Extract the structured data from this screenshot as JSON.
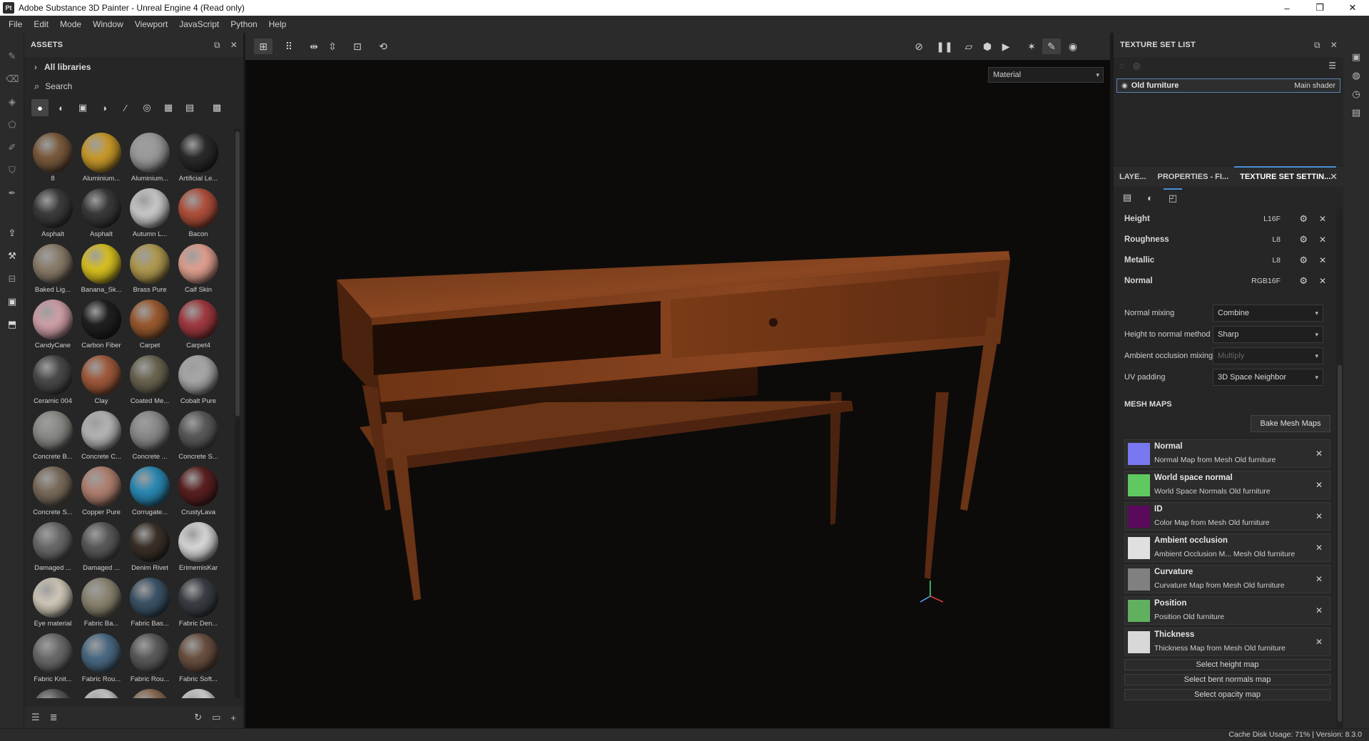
{
  "window": {
    "title": "Adobe Substance 3D Painter - Unreal Engine 4 (Read only)",
    "app_icon": "Pt",
    "controls": [
      "–",
      "❐",
      "✕"
    ]
  },
  "menu": [
    "File",
    "Edit",
    "Mode",
    "Window",
    "Viewport",
    "JavaScript",
    "Python",
    "Help"
  ],
  "assets_panel": {
    "title": "ASSETS",
    "library": "All libraries",
    "search_placeholder": "Search",
    "items": [
      {
        "label": "8",
        "color": "#7a5a3c"
      },
      {
        "label": "Aluminium...",
        "color": "#c99a2a"
      },
      {
        "label": "Aluminium...",
        "color": "#9a9a9a"
      },
      {
        "label": "Artificial Le...",
        "color": "#2a2a2a"
      },
      {
        "label": "Asphalt",
        "color": "#3c3c3c"
      },
      {
        "label": "Asphalt",
        "color": "#3a3a3a"
      },
      {
        "label": "Autumn L...",
        "color": "#c9c9c9"
      },
      {
        "label": "Bacon",
        "color": "#b0503c"
      },
      {
        "label": "Baked Lig...",
        "color": "#8a7c6a"
      },
      {
        "label": "Banana_Sk...",
        "color": "#d8c020"
      },
      {
        "label": "Brass Pure",
        "color": "#b09a50"
      },
      {
        "label": "Calf Skin",
        "color": "#e0a090"
      },
      {
        "label": "CandyCane",
        "color": "#d0a0a8"
      },
      {
        "label": "Carbon Fiber",
        "color": "#202020"
      },
      {
        "label": "Carpet",
        "color": "#9a5a30"
      },
      {
        "label": "Carpet4",
        "color": "#a03a40"
      },
      {
        "label": "Ceramic 004",
        "color": "#4a4a4a"
      },
      {
        "label": "Clay",
        "color": "#a05a3c"
      },
      {
        "label": "Coated Me...",
        "color": "#6a6450"
      },
      {
        "label": "Cobalt Pure",
        "color": "#a8a8a8"
      },
      {
        "label": "Concrete B...",
        "color": "#8a8a86"
      },
      {
        "label": "Concrete C...",
        "color": "#b4b4b4"
      },
      {
        "label": "Concrete ...",
        "color": "#8a8a8a"
      },
      {
        "label": "Concrete S...",
        "color": "#5a5a5a"
      },
      {
        "label": "Concrete S...",
        "color": "#7a6c5c"
      },
      {
        "label": "Copper Pure",
        "color": "#b08070"
      },
      {
        "label": "Corrugate...",
        "color": "#2a8ab4"
      },
      {
        "label": "CrustyLava",
        "color": "#5a2020"
      },
      {
        "label": "Damaged ...",
        "color": "#6a6a6a"
      },
      {
        "label": "Damaged ...",
        "color": "#5a5a5a"
      },
      {
        "label": "Denim Rivet",
        "color": "#3a3028"
      },
      {
        "label": "ErimemisKar",
        "color": "#d8d8d8"
      },
      {
        "label": "Eye material",
        "color": "#d0c8b8"
      },
      {
        "label": "Fabric Ba...",
        "color": "#8a8470"
      },
      {
        "label": "Fabric Bas...",
        "color": "#3c5468"
      },
      {
        "label": "Fabric Den...",
        "color": "#3a3e44"
      },
      {
        "label": "Fabric Knit...",
        "color": "#6a6a6a"
      },
      {
        "label": "Fabric Rou...",
        "color": "#4a6a84"
      },
      {
        "label": "Fabric Rou...",
        "color": "#5a5a5a"
      },
      {
        "label": "Fabric Soft...",
        "color": "#6a5040"
      },
      {
        "label": "",
        "color": "#5a5a5a"
      },
      {
        "label": "",
        "color": "#c8c8c8"
      },
      {
        "label": "",
        "color": "#8a6a50"
      },
      {
        "label": "",
        "color": "#d0d0d0"
      }
    ]
  },
  "viewport": {
    "mode_dropdown": "Material"
  },
  "texture_set_list": {
    "title": "TEXTURE SET LIST",
    "item_name": "Old furniture",
    "item_shader": "Main shader"
  },
  "tabs": {
    "layers": "LAYE...",
    "properties": "PROPERTIES - FI...",
    "tss": "TEXTURE SET SETTIN..."
  },
  "channels": [
    {
      "name": "Height",
      "format": "L16F"
    },
    {
      "name": "Roughness",
      "format": "L8"
    },
    {
      "name": "Metallic",
      "format": "L8"
    },
    {
      "name": "Normal",
      "format": "RGB16F"
    }
  ],
  "settings": [
    {
      "label": "Normal mixing",
      "value": "Combine",
      "disabled": false
    },
    {
      "label": "Height to normal method",
      "value": "Sharp",
      "disabled": false
    },
    {
      "label": "Ambient occlusion mixing",
      "value": "Multiply",
      "disabled": true
    },
    {
      "label": "UV padding",
      "value": "3D Space Neighbor",
      "disabled": false
    }
  ],
  "mesh_maps": {
    "title": "MESH MAPS",
    "bake_button": "Bake Mesh Maps",
    "items": [
      {
        "name": "Normal",
        "desc": "Normal Map from Mesh Old furniture",
        "thumb": "#7878f0"
      },
      {
        "name": "World space normal",
        "desc": "World Space Normals Old furniture",
        "thumb": "#60c860"
      },
      {
        "name": "ID",
        "desc": "Color Map from Mesh Old furniture",
        "thumb": "#5a0a5a"
      },
      {
        "name": "Ambient occlusion",
        "desc": "Ambient Occlusion M... Mesh Old furniture",
        "thumb": "#e0e0e0"
      },
      {
        "name": "Curvature",
        "desc": "Curvature Map from Mesh Old furniture",
        "thumb": "#808080"
      },
      {
        "name": "Position",
        "desc": "Position Old furniture",
        "thumb": "#60b060"
      },
      {
        "name": "Thickness",
        "desc": "Thickness Map from Mesh Old furniture",
        "thumb": "#d8d8d8"
      }
    ],
    "select_buttons": [
      "Select height map",
      "Select bent normals map",
      "Select opacity map"
    ]
  },
  "status": {
    "text": "Cache Disk Usage:   71% | Version: 8.3.0"
  }
}
